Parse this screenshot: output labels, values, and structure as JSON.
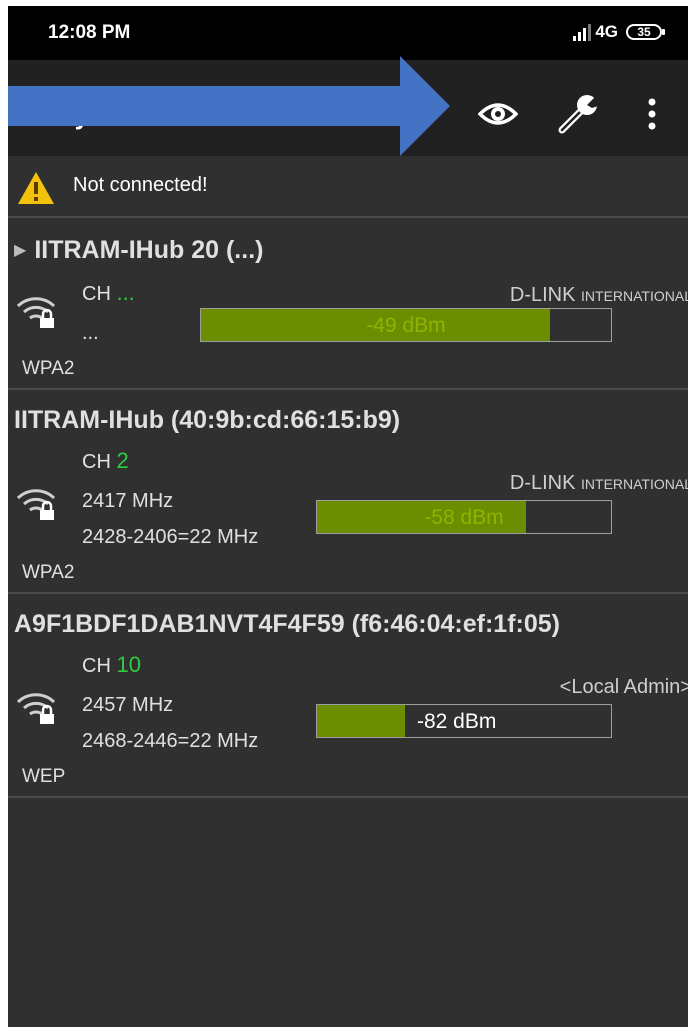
{
  "status_bar": {
    "time": "12:08 PM",
    "network": "4G",
    "network_sub": "⊥↑",
    "battery": "35"
  },
  "toolbar": {
    "title": "... ...y...",
    "icons": [
      "eye-icon",
      "wrench-icon",
      "overflow-menu-icon"
    ]
  },
  "connection": {
    "status": "Not connected!"
  },
  "networks": [
    {
      "ssid": "IITRAM-IHub 20 (...)",
      "collapsed_marker": "▶",
      "channel_label": "CH",
      "channel": "...",
      "frequency": "...",
      "range": "",
      "vendor_main": "D-LINK",
      "vendor_sub": "INTERNATIONAL",
      "security": "WPA2",
      "signal_text": "-49 dBm",
      "signal_fraction": 0.85
    },
    {
      "ssid": "IITRAM-IHub (40:9b:cd:66:15:b9)",
      "collapsed_marker": "",
      "channel_label": "CH",
      "channel": "2",
      "frequency": "2417 MHz",
      "range": "2428-2406=22 MHz",
      "vendor_main": "D-LINK",
      "vendor_sub": "INTERNATIONAL",
      "security": "WPA2",
      "signal_text": "-58 dBm",
      "signal_fraction": 0.71
    },
    {
      "ssid": "A9F1BDF1DAB1NVT4F4F59 (f6:46:04:ef:1f:05)",
      "collapsed_marker": "",
      "channel_label": "CH",
      "channel": "10",
      "frequency": "2457 MHz",
      "range": "2468-2446=22 MHz",
      "vendor_main": "<Local Admin>",
      "vendor_sub": "",
      "security": "WEP",
      "signal_text": "-82 dBm",
      "signal_fraction": 0.3
    }
  ],
  "colors": {
    "accent_green": "#2ecc40",
    "signal_fill": "#6b8e00",
    "arrow_blue": "#4472c4",
    "warning_yellow": "#f4c20d"
  }
}
